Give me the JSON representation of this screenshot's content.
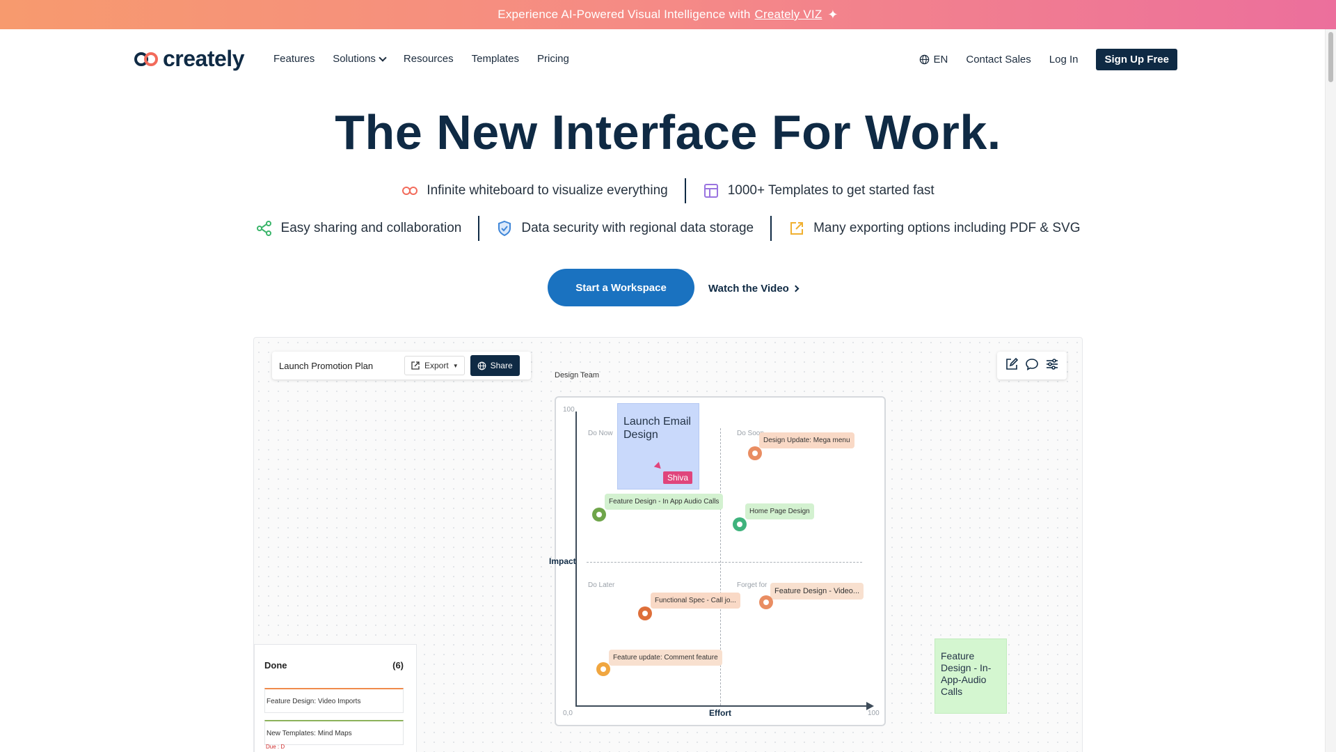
{
  "promo": {
    "text": "Experience AI-Powered Visual Intelligence with",
    "link": "Creately VIZ"
  },
  "nav": {
    "logo": "creately",
    "menu": [
      "Features",
      "Solutions",
      "Resources",
      "Templates",
      "Pricing"
    ],
    "language": "EN",
    "contact_sales": "Contact Sales",
    "log_in": "Log In",
    "sign_up": "Sign Up Free"
  },
  "hero": {
    "title": "The New Interface For Work.",
    "features_row1": [
      {
        "icon": "infinity-icon",
        "text": "Infinite whiteboard to visualize everything"
      },
      {
        "icon": "template-icon",
        "text": "1000+ Templates to get started fast"
      }
    ],
    "features_row2": [
      {
        "icon": "share-icon",
        "text": "Easy sharing and collaboration"
      },
      {
        "icon": "shield-icon",
        "text": "Data security with regional data storage"
      },
      {
        "icon": "export-icon",
        "text": "Many exporting options including PDF & SVG"
      }
    ],
    "cta_primary": "Start a Workspace",
    "cta_secondary": "Watch the Video"
  },
  "canvas": {
    "doc_title": "Launch Promotion Plan",
    "export_label": "Export",
    "share_label": "Share",
    "design_team_label": "Design Team",
    "matrix": {
      "y_max": "100",
      "origin": "0,0",
      "x_max": "100",
      "y_axis": "Impact",
      "x_axis": "Effort",
      "quadrants": [
        "Do Now",
        "Do Soon",
        "Do Later",
        "Forget for"
      ],
      "sticky_text": "Launch Email Design",
      "cursor_name": "Shiva",
      "items": [
        "Design Update: Mega menu",
        "Feature Design - In App Audio Calls",
        "Home Page Design",
        "Functional Spec - Call jo...",
        "Feature Design - Video...",
        "Feature update: Comment feature"
      ]
    },
    "kanban": {
      "title": "Done",
      "count": "(6)",
      "cards": [
        "Feature Design: Video Imports",
        "New Templates: Mind Maps"
      ],
      "due": "Due : D"
    },
    "sticky_right": "Feature Design - In-App-Audio Calls"
  },
  "colors": {
    "brand_navy": "#0f2a44",
    "cta_blue": "#1a72c0",
    "promo_start": "#f79a6e",
    "promo_end": "#ec6f9c"
  }
}
